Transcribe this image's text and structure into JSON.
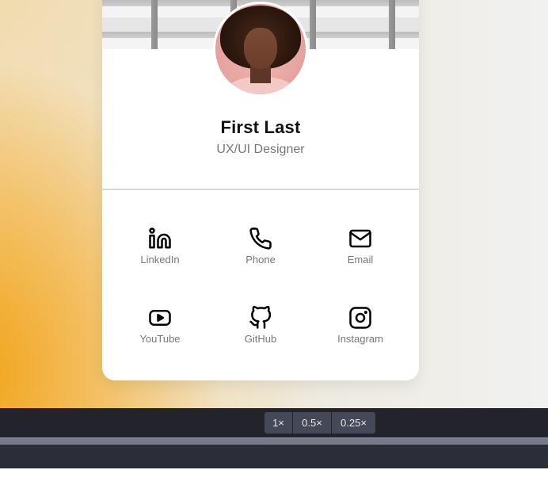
{
  "profile": {
    "name": "First Last",
    "role": "UX/UI Designer"
  },
  "links": [
    {
      "label": "LinkedIn",
      "icon": "linkedin-icon"
    },
    {
      "label": "Phone",
      "icon": "phone-icon"
    },
    {
      "label": "Email",
      "icon": "email-icon"
    },
    {
      "label": "YouTube",
      "icon": "youtube-icon"
    },
    {
      "label": "GitHub",
      "icon": "github-icon"
    },
    {
      "label": "Instagram",
      "icon": "instagram-icon"
    }
  ],
  "zoom_controls": [
    {
      "label": "1×"
    },
    {
      "label": "0.5×"
    },
    {
      "label": "0.25×"
    }
  ],
  "colors": {
    "background_accent": "#f2a214",
    "card": "#ffffff",
    "text_primary": "#111111",
    "text_secondary": "#777777",
    "toolbar": "#22232b",
    "zoom_button": "#454856"
  }
}
